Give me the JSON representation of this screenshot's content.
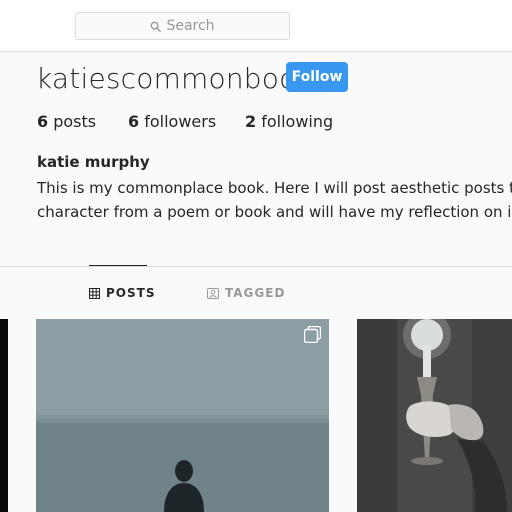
{
  "search": {
    "placeholder": "Search"
  },
  "profile": {
    "username": "katiescommonbook",
    "follow_label": "Follow",
    "stats": {
      "posts_count": "6",
      "posts_label": "posts",
      "followers_count": "6",
      "followers_label": "followers",
      "following_count": "2",
      "following_label": "following"
    },
    "full_name": "katie murphy",
    "bio_line1": "This is my commonplace book. Here I will post aesthetic posts that a",
    "bio_line2": "character from a poem or book and will have my reflection on it."
  },
  "tabs": [
    {
      "label": "POSTS",
      "icon": "grid-icon",
      "active": true
    },
    {
      "label": "TAGGED",
      "icon": "tagged-icon",
      "active": false
    }
  ],
  "colors": {
    "accent": "#3897f0",
    "background": "#fafafa",
    "border": "#dbdbdb",
    "text": "#262626",
    "muted": "#999999"
  }
}
